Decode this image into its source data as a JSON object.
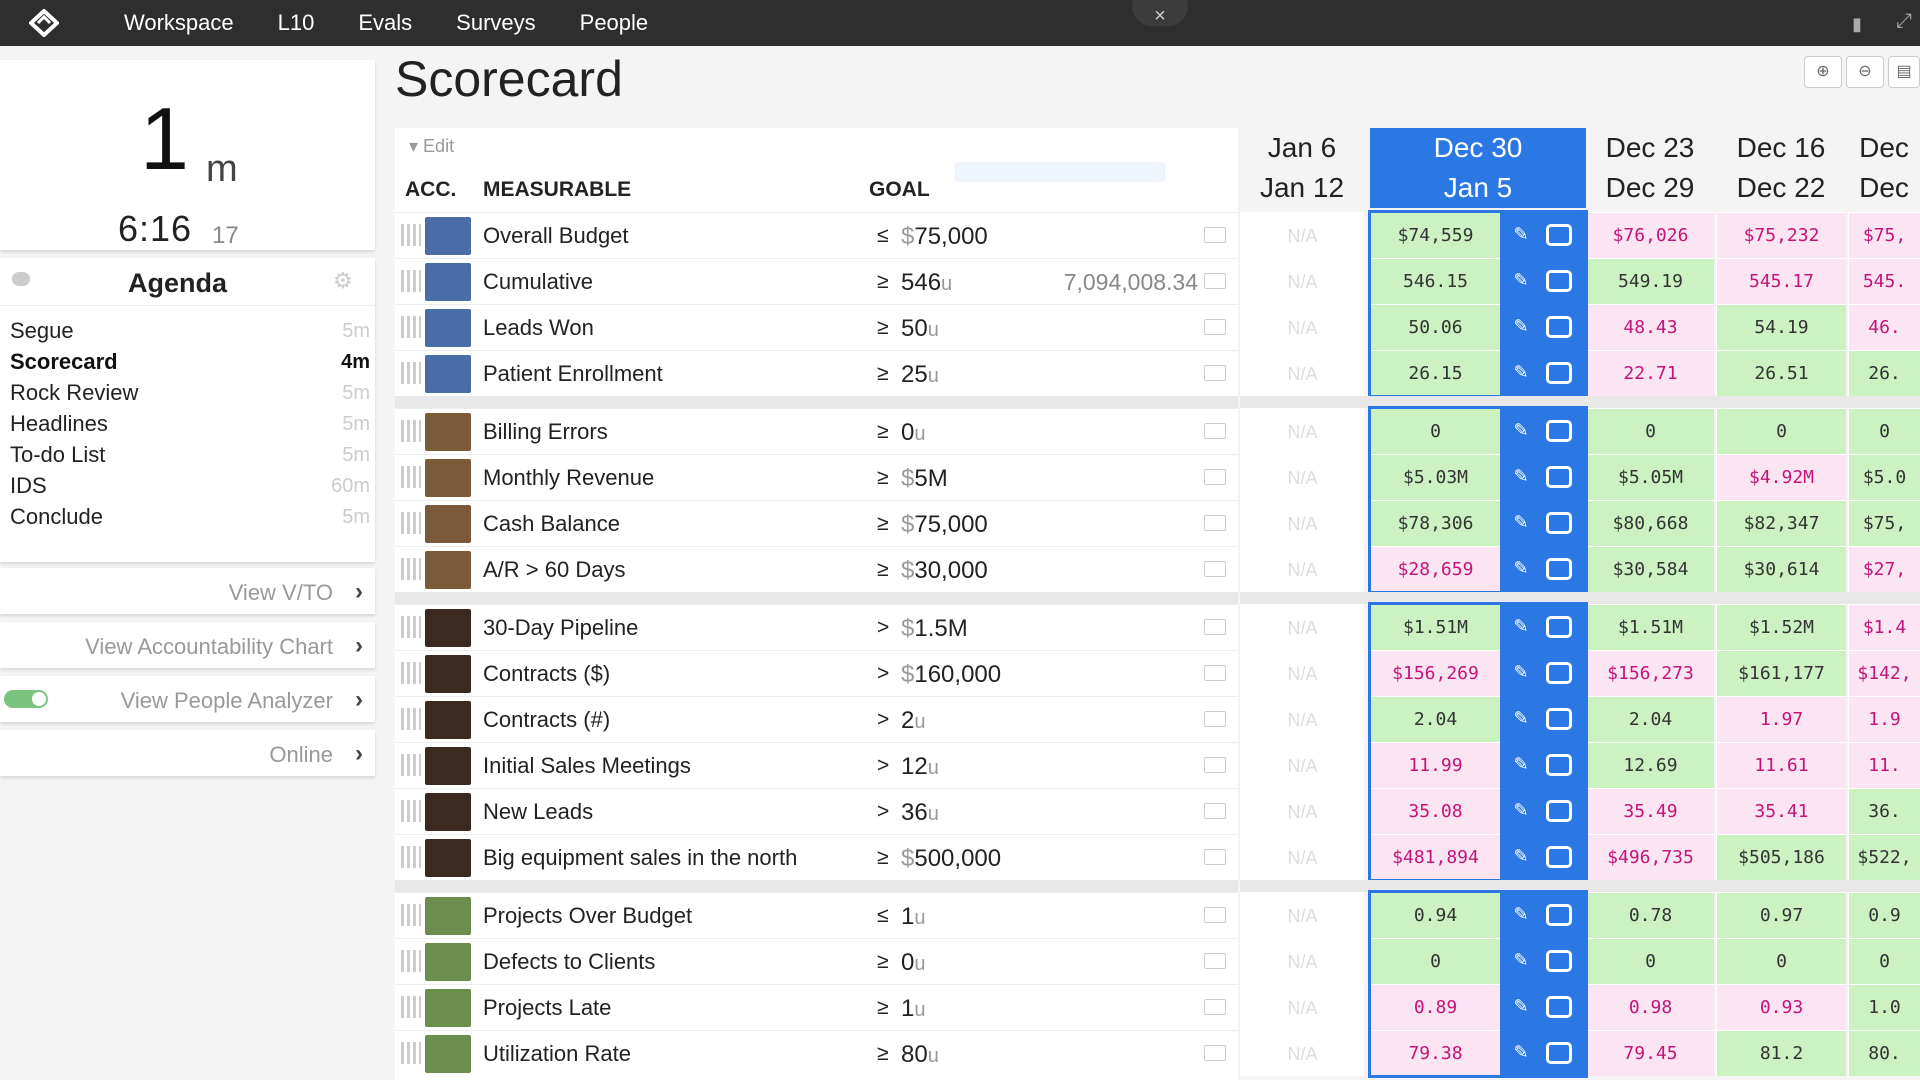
{
  "nav": {
    "items": [
      "Workspace",
      "L10",
      "Evals",
      "Surveys",
      "People"
    ],
    "close_glyph": "×",
    "bookmark_glyph": "▮",
    "expand_glyph": "⤢"
  },
  "timer": {
    "minutes": "1",
    "minutes_unit": "m",
    "clock": "6:16",
    "seconds": "17"
  },
  "agenda": {
    "title": "Agenda",
    "items": [
      {
        "label": "Segue",
        "time": "5m"
      },
      {
        "label": "Scorecard",
        "time": "4m",
        "active": true
      },
      {
        "label": "Rock Review",
        "time": "5m"
      },
      {
        "label": "Headlines",
        "time": "5m"
      },
      {
        "label": "To-do List",
        "time": "5m"
      },
      {
        "label": "IDS",
        "time": "60m"
      },
      {
        "label": "Conclude",
        "time": "5m"
      }
    ]
  },
  "side_links": {
    "vto": "View V/TO",
    "accountability": "View Accountability Chart",
    "people_analyzer": "View People Analyzer",
    "online": "Online"
  },
  "scorecard": {
    "title": "Scorecard",
    "edit": "Edit",
    "headers": {
      "acc": "ACC.",
      "measurable": "MEASURABLE",
      "goal": "GOAL"
    },
    "weeks": [
      {
        "start": "Jan 6",
        "end": "Jan 12"
      },
      {
        "start": "Dec 30",
        "end": "Jan 5",
        "current": true
      },
      {
        "start": "Dec 23",
        "end": "Dec 29"
      },
      {
        "start": "Dec 16",
        "end": "Dec 22"
      },
      {
        "start": "Dec",
        "end": "Dec"
      }
    ],
    "na_text": "N/A",
    "groups": [
      {
        "avatar_color": "#4a6da8",
        "rows": [
          {
            "name": "Overall Budget",
            "op": "≤",
            "goal_prefix": "$",
            "goal": "75,000",
            "unit": "",
            "extra": "",
            "values": [
              "$74,559",
              "$76,026",
              "$75,232",
              "$75,"
            ],
            "status": [
              "ok",
              "bad",
              "bad",
              "bad"
            ]
          },
          {
            "name": "Cumulative",
            "op": "≥",
            "goal_prefix": "",
            "goal": "546",
            "unit": "u",
            "extra": "7,094,008.34",
            "values": [
              "546.15",
              "549.19",
              "545.17",
              "545."
            ],
            "status": [
              "ok",
              "ok",
              "bad",
              "bad"
            ]
          },
          {
            "name": "Leads Won",
            "op": "≥",
            "goal_prefix": "",
            "goal": "50",
            "unit": "u",
            "extra": "",
            "values": [
              "50.06",
              "48.43",
              "54.19",
              "46."
            ],
            "status": [
              "ok",
              "bad",
              "ok",
              "bad"
            ]
          },
          {
            "name": "Patient Enrollment",
            "op": "≥",
            "goal_prefix": "",
            "goal": "25",
            "unit": "u",
            "extra": "",
            "values": [
              "26.15",
              "22.71",
              "26.51",
              "26."
            ],
            "status": [
              "ok",
              "bad",
              "ok",
              "ok"
            ]
          }
        ]
      },
      {
        "avatar_color": "#7a5a3a",
        "rows": [
          {
            "name": "Billing Errors",
            "op": "≥",
            "goal_prefix": "",
            "goal": "0",
            "unit": "u",
            "extra": "",
            "values": [
              "0",
              "0",
              "0",
              "0"
            ],
            "status": [
              "ok",
              "ok",
              "ok",
              "ok"
            ]
          },
          {
            "name": "Monthly Revenue",
            "op": "≥",
            "goal_prefix": "$",
            "goal": "5M",
            "unit": "",
            "extra": "",
            "values": [
              "$5.03M",
              "$5.05M",
              "$4.92M",
              "$5.0"
            ],
            "status": [
              "ok",
              "ok",
              "bad",
              "ok"
            ]
          },
          {
            "name": "Cash Balance",
            "op": "≥",
            "goal_prefix": "$",
            "goal": "75,000",
            "unit": "",
            "extra": "",
            "values": [
              "$78,306",
              "$80,668",
              "$82,347",
              "$75,"
            ],
            "status": [
              "ok",
              "ok",
              "ok",
              "ok"
            ]
          },
          {
            "name": "A/R > 60 Days",
            "op": "≥",
            "goal_prefix": "$",
            "goal": "30,000",
            "unit": "",
            "extra": "",
            "values": [
              "$28,659",
              "$30,584",
              "$30,614",
              "$27,"
            ],
            "status": [
              "bad",
              "ok",
              "ok",
              "bad"
            ]
          }
        ]
      },
      {
        "avatar_color": "#3a2a22",
        "rows": [
          {
            "name": "30-Day Pipeline",
            "op": ">",
            "goal_prefix": "$",
            "goal": "1.5M",
            "unit": "",
            "extra": "",
            "values": [
              "$1.51M",
              "$1.51M",
              "$1.52M",
              "$1.4"
            ],
            "status": [
              "ok",
              "ok",
              "ok",
              "bad"
            ]
          },
          {
            "name": "Contracts ($)",
            "op": ">",
            "goal_prefix": "$",
            "goal": "160,000",
            "unit": "",
            "extra": "",
            "values": [
              "$156,269",
              "$156,273",
              "$161,177",
              "$142,"
            ],
            "status": [
              "bad",
              "bad",
              "ok",
              "bad"
            ]
          },
          {
            "name": "Contracts (#)",
            "op": ">",
            "goal_prefix": "",
            "goal": "2",
            "unit": "u",
            "extra": "",
            "values": [
              "2.04",
              "2.04",
              "1.97",
              "1.9"
            ],
            "status": [
              "ok",
              "ok",
              "bad",
              "bad"
            ]
          },
          {
            "name": "Initial Sales Meetings",
            "op": ">",
            "goal_prefix": "",
            "goal": "12",
            "unit": "u",
            "extra": "",
            "values": [
              "11.99",
              "12.69",
              "11.61",
              "11."
            ],
            "status": [
              "bad",
              "ok",
              "bad",
              "bad"
            ]
          },
          {
            "name": "New Leads",
            "op": ">",
            "goal_prefix": "",
            "goal": "36",
            "unit": "u",
            "extra": "",
            "values": [
              "35.08",
              "35.49",
              "35.41",
              "36."
            ],
            "status": [
              "bad",
              "bad",
              "bad",
              "ok"
            ]
          },
          {
            "name": "Big equipment sales in the north",
            "op": "≥",
            "goal_prefix": "$",
            "goal": "500,000",
            "unit": "",
            "extra": "",
            "values": [
              "$481,894",
              "$496,735",
              "$505,186",
              "$522,"
            ],
            "status": [
              "bad",
              "bad",
              "ok",
              "ok"
            ]
          }
        ]
      },
      {
        "avatar_color": "#6b8e4e",
        "rows": [
          {
            "name": "Projects Over Budget",
            "op": "≤",
            "goal_prefix": "",
            "goal": "1",
            "unit": "u",
            "extra": "",
            "values": [
              "0.94",
              "0.78",
              "0.97",
              "0.9"
            ],
            "status": [
              "ok",
              "ok",
              "ok",
              "ok"
            ]
          },
          {
            "name": "Defects to Clients",
            "op": "≥",
            "goal_prefix": "",
            "goal": "0",
            "unit": "u",
            "extra": "",
            "values": [
              "0",
              "0",
              "0",
              "0"
            ],
            "status": [
              "ok",
              "ok",
              "ok",
              "ok"
            ]
          },
          {
            "name": "Projects Late",
            "op": "≥",
            "goal_prefix": "",
            "goal": "1",
            "unit": "u",
            "extra": "",
            "values": [
              "0.89",
              "0.98",
              "0.93",
              "1.0"
            ],
            "status": [
              "bad",
              "bad",
              "bad",
              "ok"
            ]
          },
          {
            "name": "Utilization Rate",
            "op": "≥",
            "goal_prefix": "",
            "goal": "80",
            "unit": "u",
            "extra": "",
            "values": [
              "79.38",
              "79.45",
              "81.2",
              "80."
            ],
            "status": [
              "bad",
              "bad",
              "ok",
              "ok"
            ]
          }
        ]
      }
    ]
  },
  "colors": {
    "accent": "#2b78e4",
    "ok": "#cbf2c0",
    "bad_bg": "#fbe5f2",
    "bad_text": "#c2147a",
    "nav_bg": "#2e2e2e"
  }
}
